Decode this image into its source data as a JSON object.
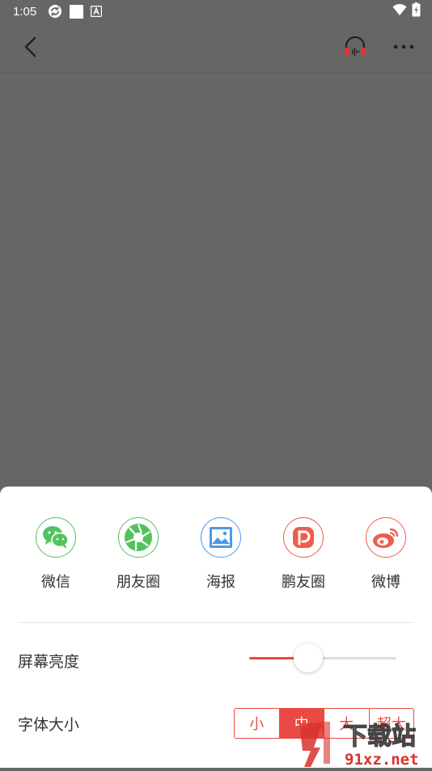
{
  "status_bar": {
    "time": "1:05",
    "left_icons": [
      "sync-icon",
      "white-square-icon",
      "keyboard-a-icon"
    ],
    "right_icons": [
      "wifi-icon",
      "battery-charging-icon"
    ]
  },
  "toolbar": {
    "back_icon": "back-arrow-icon",
    "listen_icon": "headphones-icon",
    "more_icon": "more-dots-icon"
  },
  "share": {
    "items": [
      {
        "label": "微信",
        "icon": "wechat-icon",
        "color": "#53c25e"
      },
      {
        "label": "朋友圈",
        "icon": "moments-icon",
        "color": "#53c25e"
      },
      {
        "label": "海报",
        "icon": "poster-icon",
        "color": "#4a9be8"
      },
      {
        "label": "鹏友圈",
        "icon": "pengyouquan-icon",
        "color": "#ef5c4b"
      },
      {
        "label": "微博",
        "icon": "weibo-icon",
        "color": "#ef5c4b"
      }
    ]
  },
  "settings": {
    "brightness_label": "屏幕亮度",
    "brightness_value": 0.4,
    "font_size_label": "字体大小",
    "font_size_options": [
      "小",
      "中",
      "大",
      "超大"
    ],
    "font_size_selected": "中"
  },
  "watermark": {
    "text_top": "下载站",
    "text_bottom": "91xz.net"
  },
  "colors": {
    "accent": "#e94a43",
    "overlay": "#666666",
    "sheet": "#ffffff"
  }
}
